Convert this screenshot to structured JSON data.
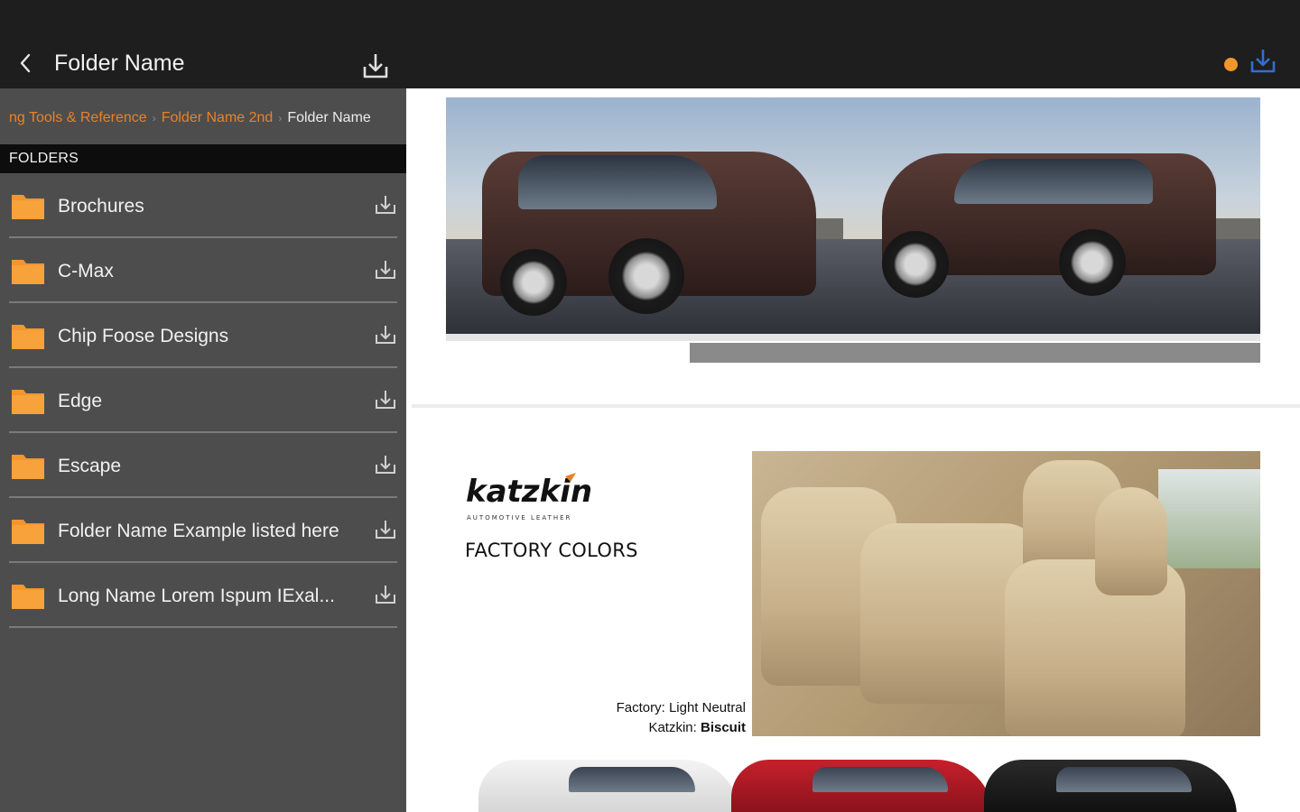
{
  "header": {
    "title": "Folder Name"
  },
  "breadcrumb": {
    "items": [
      "ng Tools & Reference",
      "Folder Name 2nd"
    ],
    "current": "Folder Name"
  },
  "folders": {
    "header": "FOLDERS",
    "items": [
      {
        "label": "Brochures"
      },
      {
        "label": "C-Max"
      },
      {
        "label": "Chip Foose Designs"
      },
      {
        "label": "Edge"
      },
      {
        "label": "Escape"
      },
      {
        "label": "Folder Name Example listed here"
      },
      {
        "label": "Long Name Lorem Ispum IExal..."
      }
    ]
  },
  "document": {
    "brand": "katzkin",
    "brand_tagline": "AUTOMOTIVE LEATHER",
    "section_title": "FACTORY COLORS",
    "caption_factory_label": "Factory:",
    "caption_factory_value": "Light Neutral",
    "caption_katzkin_label": "Katzkin:",
    "caption_katzkin_value": "Biscuit"
  },
  "colors": {
    "accent": "#e8822b",
    "sidebar_bg": "#4d4d4d",
    "topbar_bg": "#1e1e1e",
    "status_dot": "#f0962a",
    "download_icon_active": "#2f6fd6"
  },
  "icons": {
    "back": "chevron-left-icon",
    "download": "download-icon",
    "folder": "folder-icon",
    "status": "status-dot-icon"
  }
}
